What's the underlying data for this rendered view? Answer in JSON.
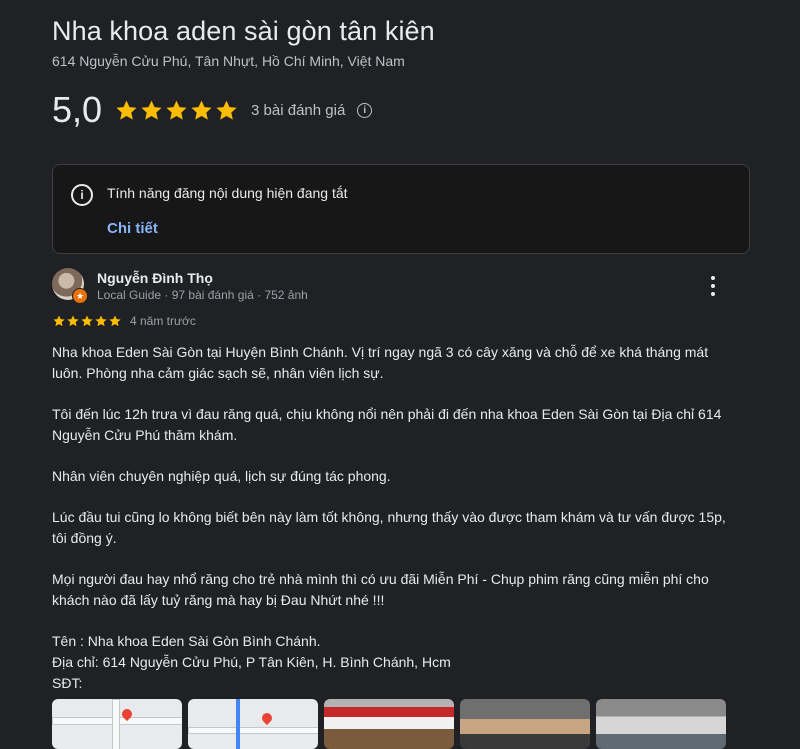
{
  "place": {
    "title": "Nha khoa aden sài gòn tân kiên",
    "address": "614 Nguyễn Cửu Phú, Tân Nhựt, Hồ Chí Minh, Việt Nam",
    "rating": "5,0",
    "stars": 5,
    "review_count": "3 bài đánh giá",
    "info_glyph": "i"
  },
  "notice": {
    "text": "Tính năng đăng nội dung hiện đang tắt",
    "link": "Chi tiết",
    "icon": "info-icon"
  },
  "review": {
    "author": "Nguyễn Đình Thọ",
    "meta": "Local Guide · 97 bài đánh giá · 752 ảnh",
    "stars": 5,
    "time": "4 năm trước",
    "paragraphs": [
      "Nha khoa Eden Sài Gòn tại Huyện Bình Chánh. Vị trí ngay ngã 3 có cây xăng và chỗ để xe khá tháng mát luôn. Phòng nha cảm giác sạch sẽ, nhân viên lịch sự.",
      "Tôi đến lúc 12h trưa vì đau răng quá, chịu không nổi nên phải đi đến nha khoa Eden Sài Gòn tại Địa chỉ 614 Nguyễn Cửu Phú thăm khám.",
      "Nhân viên chuyên nghiệp quá, lịch sự đúng tác phong.",
      "Lúc đầu tui cũng lo không biết bên này làm tốt không, nhưng thấy vào được tham khám và tư vấn được 15p, tôi đồng ý.",
      "Mọi người đau hay nhổ răng cho trẻ nhà mình thì có ưu đãi Miễn Phí - Chụp phim răng cũng miễn phí cho khách nào đã lấy tuỷ răng mà hay bị Đau Nhứt nhé !!!"
    ],
    "contact_lines": [
      "Tên : Nha khoa Eden Sài Gòn Bình Chánh.",
      "Địa chỉ: 614 Nguyễn Cửu Phú, P Tân Kiên, H. Bình Chánh, Hcm",
      "SĐT:"
    ]
  },
  "colors": {
    "background": "#202124",
    "star": "#fbbc04",
    "link": "#8ab4f8",
    "guide_badge": "#e8710a"
  }
}
